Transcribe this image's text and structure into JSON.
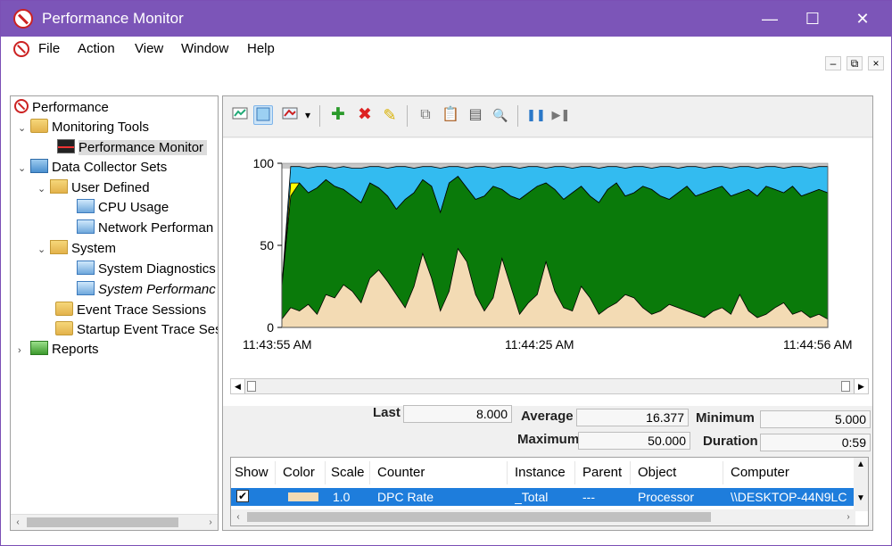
{
  "window": {
    "title": "Performance Monitor"
  },
  "menu": [
    "File",
    "Action",
    "View",
    "Window",
    "Help"
  ],
  "title_controls": {
    "minimize": "—",
    "maximize": "☐",
    "close": "✕"
  },
  "mdi_controls": {
    "minimize": "–",
    "restore": "⧉",
    "close": "×"
  },
  "tree": {
    "root": "Performance",
    "monitoring_tools": "Monitoring Tools",
    "performance_monitor": "Performance Monitor",
    "data_collector_sets": "Data Collector Sets",
    "user_defined": "User Defined",
    "cpu_usage": "CPU Usage",
    "network_performance": "Network Performan",
    "system": "System",
    "system_diagnostics": "System Diagnostics",
    "system_performance": "System Performanc",
    "event_trace_sessions": "Event Trace Sessions",
    "startup_event_trace": "Startup Event Trace Ses",
    "reports": "Reports"
  },
  "toolbar": {
    "icons": [
      "view-current-activity-icon",
      "view-log-data-icon",
      "change-graph-type-icon",
      "dropdown-arrow-icon",
      "add-counter-icon",
      "delete-counter-icon",
      "highlight-icon",
      "copy-properties-icon",
      "paste-counter-list-icon",
      "properties-icon",
      "zoom-icon",
      "freeze-display-icon",
      "update-data-icon"
    ],
    "glyphs": {
      "add": "✚",
      "delete": "✖",
      "highlight": "✎",
      "pause": "❚❚",
      "step": "▶❚",
      "zoom": "🔍",
      "dropdown": "▾",
      "copy": "⧉",
      "paste": "📋",
      "props": "▤"
    }
  },
  "chart_data": {
    "type": "area",
    "title": "",
    "xlabel": "",
    "ylabel": "",
    "ylim": [
      0,
      100
    ],
    "yticks": [
      "100",
      "50",
      "0"
    ],
    "x_labels": [
      "11:43:55 AM",
      "11:44:25 AM",
      "11:44:56 AM"
    ],
    "colors": {
      "dpc": "#f3dbb4",
      "green": "#0a7a0a",
      "yellow": "#ffff00",
      "blue": "#33bbf0",
      "hatch": "#c8c8c8"
    },
    "series": [
      {
        "counter": "DPC Rate",
        "values": [
          5,
          12,
          10,
          14,
          8,
          20,
          18,
          26,
          22,
          15,
          30,
          35,
          28,
          20,
          12,
          25,
          45,
          30,
          10,
          22,
          48,
          40,
          20,
          10,
          18,
          42,
          25,
          8,
          15,
          20,
          40,
          22,
          12,
          10,
          25,
          18,
          8,
          12,
          15,
          20,
          18,
          12,
          8,
          10,
          14,
          12,
          10,
          8,
          6,
          10,
          12,
          8,
          20,
          10,
          6,
          8,
          12,
          15,
          8,
          10,
          6,
          8,
          5
        ]
      },
      {
        "name": "",
        "values": [
          25,
          80,
          88,
          82,
          85,
          90,
          86,
          84,
          80,
          76,
          88,
          85,
          80,
          72,
          78,
          82,
          90,
          86,
          70,
          88,
          92,
          85,
          78,
          80,
          86,
          84,
          80,
          78,
          82,
          86,
          88,
          84,
          78,
          82,
          86,
          80,
          76,
          84,
          88,
          80,
          82,
          86,
          84,
          80,
          78,
          82,
          86,
          80,
          82,
          84,
          86,
          80,
          82,
          84,
          80,
          86,
          84,
          82,
          86,
          80,
          82,
          84,
          82
        ]
      },
      {
        "name": "",
        "values": [
          25,
          88,
          88,
          82,
          85,
          90,
          86,
          84,
          80,
          76,
          88,
          85,
          80,
          72,
          78,
          82,
          90,
          86,
          70,
          88,
          92,
          85,
          78,
          80,
          86,
          84,
          80,
          78,
          82,
          86,
          88,
          84,
          78,
          82,
          86,
          80,
          76,
          84,
          88,
          80,
          82,
          86,
          84,
          80,
          78,
          82,
          86,
          80,
          82,
          84,
          86,
          80,
          82,
          84,
          80,
          86,
          84,
          82,
          86,
          80,
          82,
          84,
          82
        ]
      },
      {
        "name": "",
        "values": [
          25,
          98,
          98,
          97,
          98,
          98,
          97,
          98,
          97,
          97,
          98,
          98,
          97,
          98,
          98,
          97,
          98,
          98,
          97,
          98,
          98,
          97,
          98,
          98,
          97,
          98,
          98,
          97,
          98,
          98,
          97,
          98,
          98,
          97,
          98,
          98,
          97,
          98,
          98,
          97,
          98,
          98,
          97,
          98,
          98,
          97,
          98,
          98,
          97,
          98,
          98,
          97,
          98,
          98,
          97,
          98,
          98,
          97,
          98,
          98,
          97,
          98,
          98
        ]
      }
    ]
  },
  "stats": {
    "last_label": "Last",
    "last_value": "8.000",
    "average_label": "Average",
    "average_value": "16.377",
    "minimum_label": "Minimum",
    "minimum_value": "5.000",
    "maximum_label": "Maximum",
    "maximum_value": "50.000",
    "duration_label": "Duration",
    "duration_value": "0:59"
  },
  "counter_table": {
    "headers": [
      "Show",
      "Color",
      "Scale",
      "Counter",
      "Instance",
      "Parent",
      "Object",
      "Computer"
    ],
    "row": {
      "show": "✔",
      "color": "#f3dbb4",
      "scale": "1.0",
      "counter": "DPC Rate",
      "instance": "_Total",
      "parent": "---",
      "object": "Processor",
      "computer": "\\\\DESKTOP-44N9LC"
    }
  }
}
